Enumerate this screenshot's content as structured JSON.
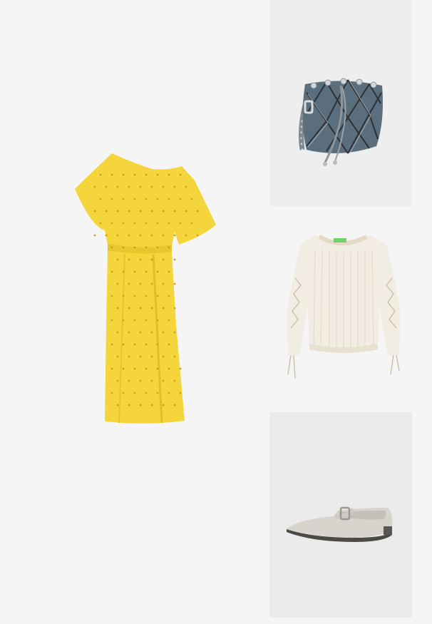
{
  "colors": {
    "page_background": "#f5f5f5",
    "dress_yellow": "#f4d63c",
    "dress_shadow": "#e2bf22",
    "dress_dots": "#c9a21a",
    "bag_denim": "#5b6e7d",
    "bag_stitch": "#2c3137",
    "bag_metal": "#c9cccf",
    "sweater_cream": "#f2ede2",
    "sweater_shadow": "#ddd5c4",
    "sweater_tag": "#6fd36a",
    "shoe_grey": "#d7d3cd",
    "shoe_sole": "#4c4a47"
  },
  "items": [
    {
      "id": "dress",
      "icon": "yellow-dress-icon"
    },
    {
      "id": "bag",
      "icon": "denim-bucket-bag-icon"
    },
    {
      "id": "sweater",
      "icon": "cream-sweater-icon"
    },
    {
      "id": "shoe",
      "icon": "grey-flat-shoe-icon"
    }
  ]
}
